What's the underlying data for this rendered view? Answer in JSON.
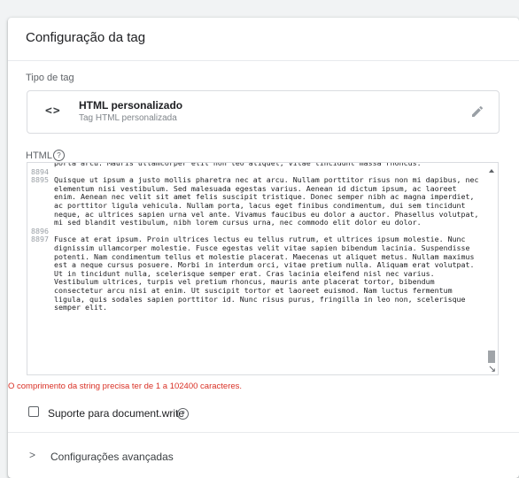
{
  "card": {
    "title": "Configuração da tag"
  },
  "tag_type": {
    "section_label": "Tipo de tag",
    "icon_glyph": "<>",
    "name": "HTML personalizado",
    "subtitle": "Tag HTML personalizada",
    "edit_icon": "pencil-icon"
  },
  "html_field": {
    "label": "HTML",
    "help_glyph": "?",
    "lines": [
      {
        "num": "",
        "text": "porta arcu. Mauris ullamcorper elit non leo aliquet, vitae tincidunt massa rhoncus."
      },
      {
        "num": "8894",
        "text": ""
      },
      {
        "num": "8895",
        "text": "Quisque ut ipsum a justo mollis pharetra nec at arcu. Nullam porttitor risus non mi dapibus, nec elementum nisi vestibulum. Sed malesuada egestas varius. Aenean id dictum ipsum, ac laoreet enim. Aenean nec velit sit amet felis suscipit tristique. Donec semper nibh ac magna imperdiet, ac porttitor ligula vehicula. Nullam porta, lacus eget finibus condimentum, dui sem tincidunt neque, ac ultrices sapien urna vel ante. Vivamus faucibus eu dolor a auctor. Phasellus volutpat, mi sed blandit vestibulum, nibh lorem cursus urna, nec commodo elit dolor eu dolor."
      },
      {
        "num": "8896",
        "text": ""
      },
      {
        "num": "8897",
        "text": "Fusce at erat ipsum. Proin ultrices lectus eu tellus rutrum, et ultrices ipsum molestie. Nunc dignissim ullamcorper molestie. Fusce egestas velit vitae sapien bibendum lacinia. Suspendisse potenti. Nam condimentum tellus et molestie placerat. Maecenas ut aliquet metus. Nullam maximus est a neque cursus posuere. Morbi in interdum orci, vitae pretium nulla. Aliquam erat volutpat. Ut in tincidunt nulla, scelerisque semper erat. Cras lacinia eleifend nisl nec varius. Vestibulum ultrices, turpis vel pretium rhoncus, mauris ante placerat tortor, bibendum consectetur arcu nisi at enim. Ut suscipit tortor et laoreet euismod. Nam luctus fermentum ligula, quis sodales sapien porttitor id. Nunc risus purus, fringilla in leo non, scelerisque semper elit."
      }
    ],
    "error": "O comprimento da string precisa ter de 1 a 102400 caracteres."
  },
  "document_write": {
    "label": "Suporte para document.write",
    "checked": false,
    "help_glyph": "?"
  },
  "advanced": {
    "chevron": ">",
    "label": "Configurações avançadas"
  },
  "colors": {
    "error": "#d93025",
    "text": "#202124",
    "secondary": "#5f6368"
  }
}
